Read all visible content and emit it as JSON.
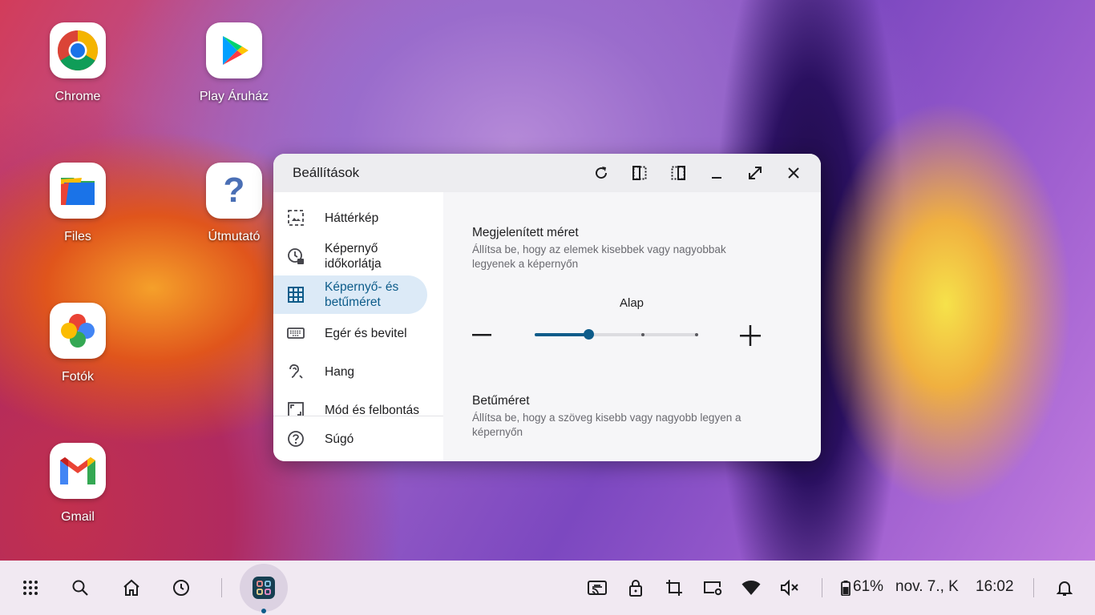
{
  "desktop": {
    "icons": [
      {
        "label": "Chrome"
      },
      {
        "label": "Play Áruház"
      },
      {
        "label": "Files"
      },
      {
        "label": "Útmutató"
      },
      {
        "label": "Fotók"
      },
      {
        "label": "Gmail"
      }
    ]
  },
  "window": {
    "title": "Beállítások",
    "controls": [
      "refresh-icon",
      "snap-left-icon",
      "snap-right-icon",
      "minimize-icon",
      "maximize-icon",
      "close-icon"
    ]
  },
  "sidebar": {
    "items": [
      {
        "label": "Háttérkép",
        "icon": "wallpaper-icon"
      },
      {
        "label": "Képernyő időkorlátja",
        "icon": "screen-time-icon"
      },
      {
        "label": "Képernyő- és betűméret",
        "icon": "grid-icon",
        "active": true
      },
      {
        "label": "Egér és bevitel",
        "icon": "keyboard-icon"
      },
      {
        "label": "Hang",
        "icon": "sound-icon"
      },
      {
        "label": "Mód és felbontás",
        "icon": "resolution-icon"
      }
    ],
    "help": {
      "label": "Súgó",
      "icon": "help-icon"
    }
  },
  "content": {
    "display_size": {
      "title": "Megjelenített méret",
      "desc": "Állítsa be, hogy az elemek kisebbek vagy nagyobbak legyenek a képernyőn",
      "value_label": "Alap",
      "steps": 4,
      "current_step": 1
    },
    "font_size": {
      "title": "Betűméret",
      "desc": "Állítsa be, hogy a szöveg kisebb vagy nagyobb legyen a képernyőn"
    }
  },
  "taskbar": {
    "battery": "61%",
    "date": "nov. 7., K",
    "time": "16:02"
  },
  "colors": {
    "accent": "#0d5c8a",
    "active_bg": "#dceaf7"
  }
}
